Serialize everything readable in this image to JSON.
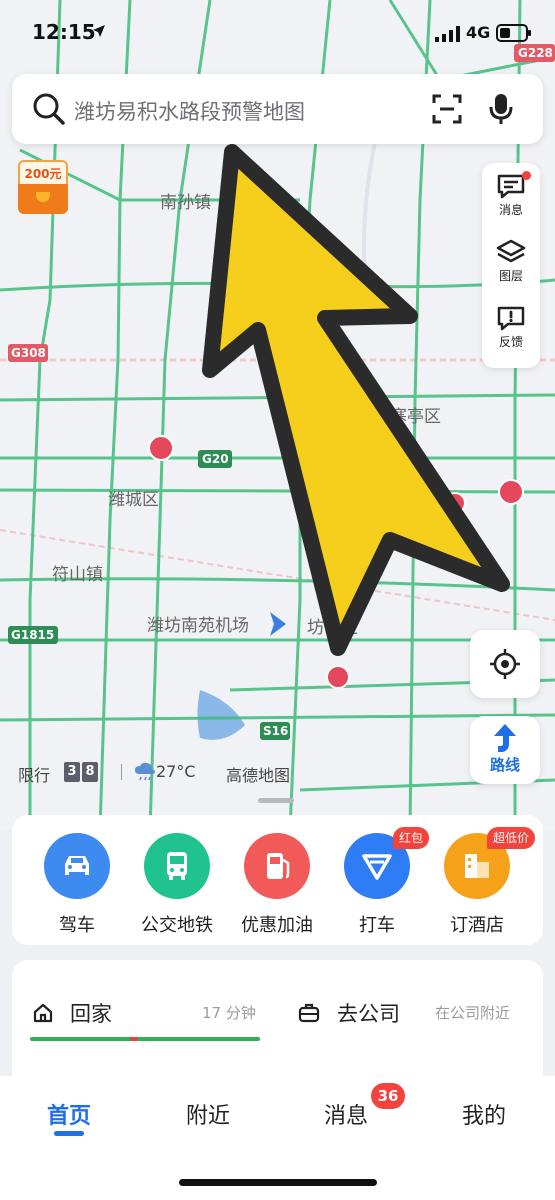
{
  "status_bar": {
    "time": "12:15",
    "network": "4G"
  },
  "search": {
    "placeholder": "潍坊易积水路段预警地图"
  },
  "coupon": {
    "label": "200元"
  },
  "side_panel": {
    "items": [
      {
        "label": "消息",
        "icon": "message-icon"
      },
      {
        "label": "图层",
        "icon": "layers-icon"
      },
      {
        "label": "反馈",
        "icon": "feedback-icon"
      }
    ]
  },
  "map": {
    "labels": [
      "南孙镇",
      "寒亭区",
      "潍城区",
      "符山镇",
      "潍坊南苑机场",
      "坊子区"
    ],
    "shields": [
      "G228",
      "G308",
      "G20",
      "G1815",
      "S16"
    ]
  },
  "info_row": {
    "restriction_label": "限行",
    "plate_numbers": [
      "3",
      "8"
    ],
    "temperature": "27°C",
    "brand": "高德地图"
  },
  "controls": {
    "route_label": "路线"
  },
  "services": [
    {
      "label": "驾车",
      "color": "#3d8bf0",
      "icon": "car-icon"
    },
    {
      "label": "公交地铁",
      "color": "#20c38e",
      "icon": "bus-icon"
    },
    {
      "label": "优惠加油",
      "color": "#f25a5a",
      "icon": "fuel-icon"
    },
    {
      "label": "打车",
      "color": "#2f7df6",
      "icon": "taxi-icon",
      "badge": "红包"
    },
    {
      "label": "订酒店",
      "color": "#f6a11a",
      "icon": "hotel-icon",
      "badge": "超低价"
    }
  ],
  "commute": {
    "home_label": "回家",
    "home_time": "17 分钟",
    "work_label": "去公司",
    "work_sub": "在公司附近"
  },
  "tabs": [
    {
      "label": "首页"
    },
    {
      "label": "附近"
    },
    {
      "label": "消息",
      "badge": "36"
    },
    {
      "label": "我的"
    }
  ],
  "colors": {
    "accent": "#1f6fe5",
    "road": "#3dbd7a",
    "arrow": "#f6cf1d"
  }
}
